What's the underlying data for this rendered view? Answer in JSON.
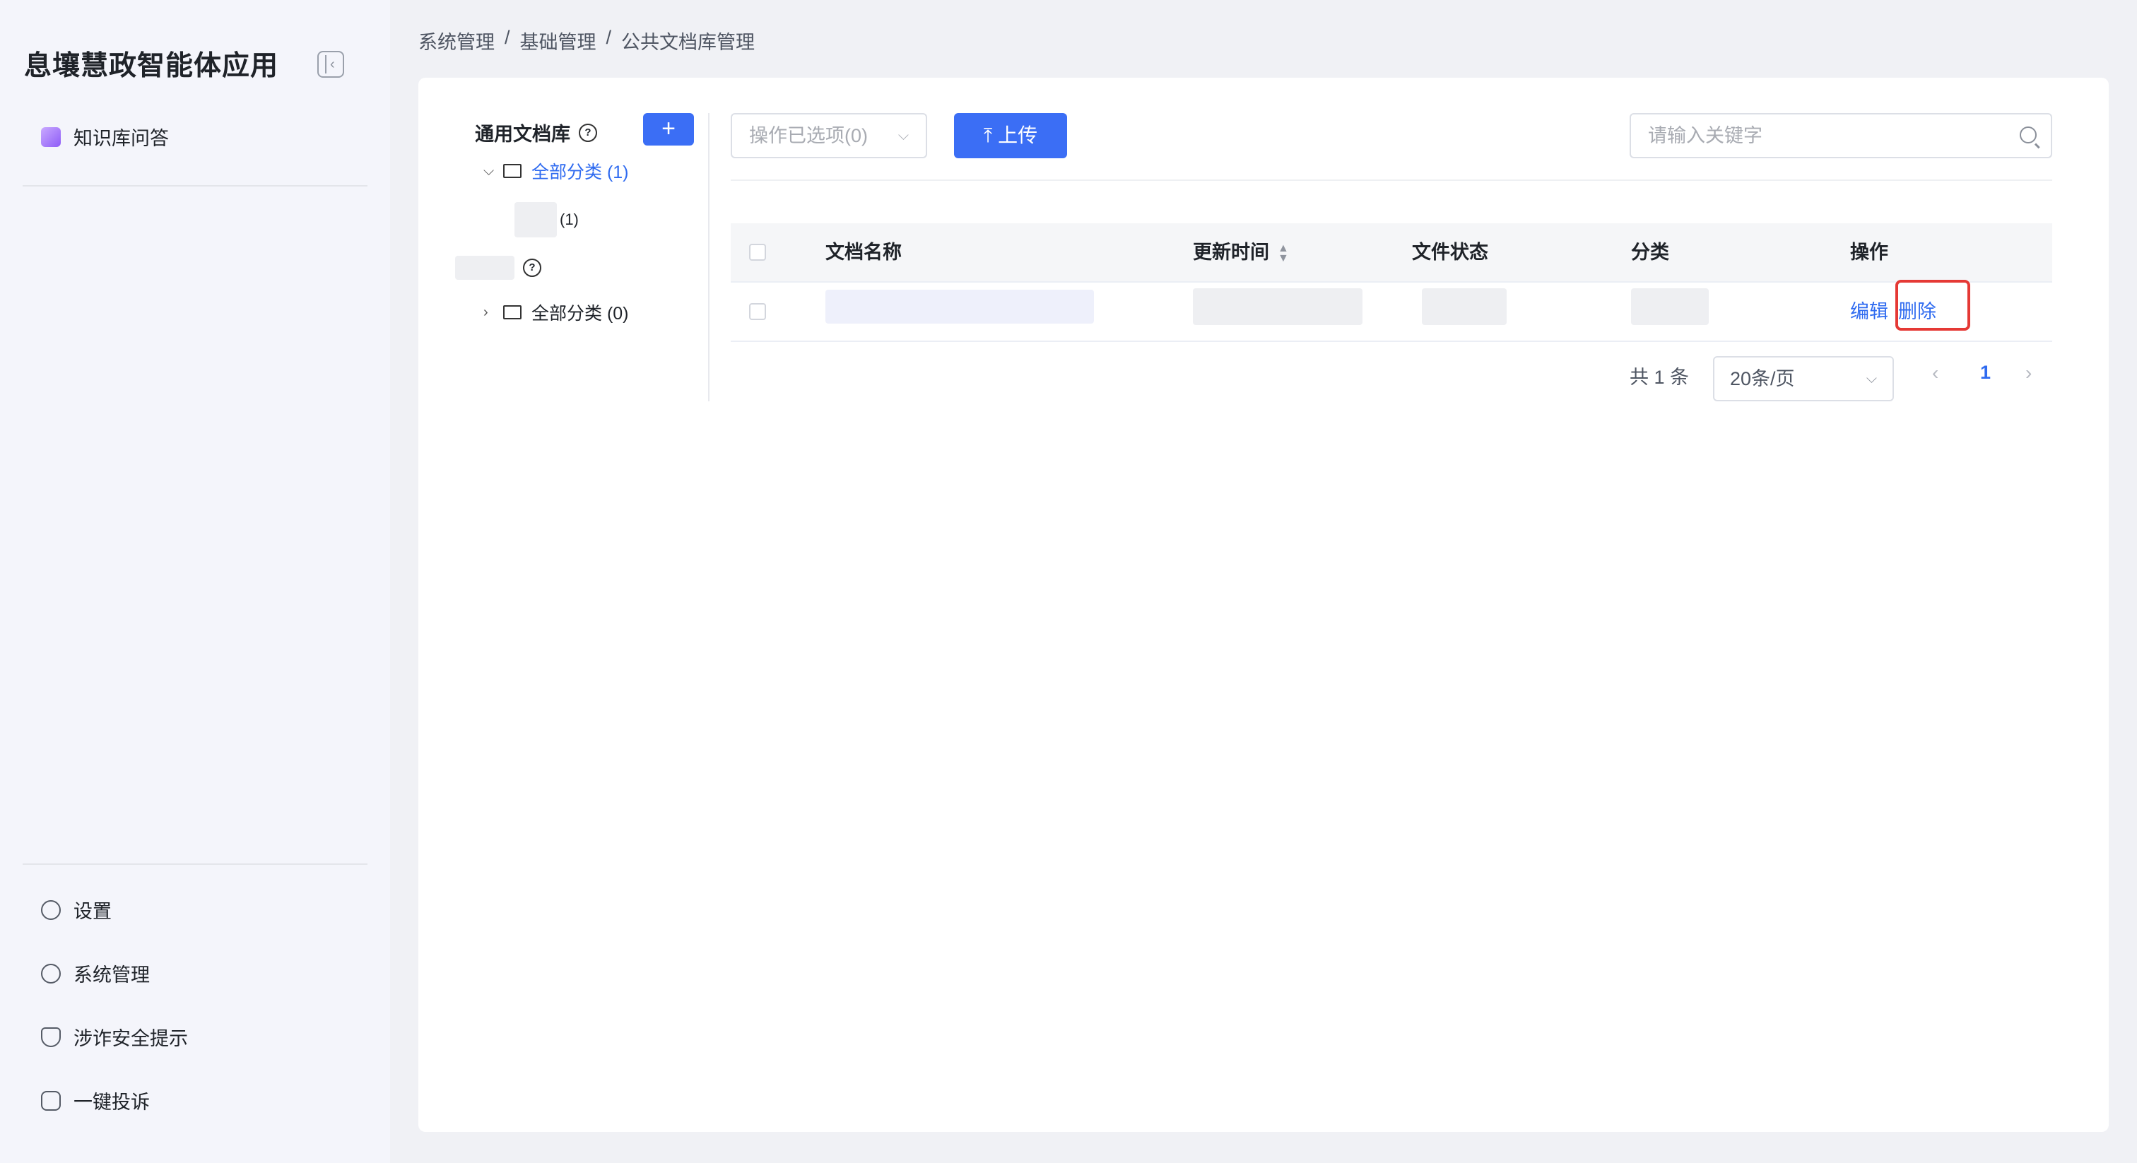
{
  "app": {
    "title": "息壤慧政智能体应用"
  },
  "sidebar": {
    "top_items": [
      {
        "label": "知识库问答",
        "icon": "knowledge-base-icon"
      }
    ],
    "bottom_items": [
      {
        "label": "设置",
        "icon": "settings-icon"
      },
      {
        "label": "系统管理",
        "icon": "user-admin-icon"
      },
      {
        "label": "涉诈安全提示",
        "icon": "shield-icon"
      },
      {
        "label": "一键投诉",
        "icon": "complaint-icon"
      }
    ]
  },
  "breadcrumb": {
    "items": [
      "系统管理",
      "基础管理",
      "公共文档库管理"
    ],
    "separator": "/"
  },
  "tree": {
    "title": "通用文档库",
    "add_label": "+",
    "nodes": [
      {
        "label": "全部分类 (1)",
        "expanded": true,
        "selected": true
      },
      {
        "label": "(1)"
      },
      {
        "label": "全部分类 (0)",
        "expanded": false
      }
    ]
  },
  "toolbar": {
    "ops_select": "操作已选项(0)",
    "upload_label": "上传",
    "search_placeholder": "请输入关键字"
  },
  "table": {
    "columns": [
      "文档名称",
      "更新时间",
      "文件状态",
      "分类",
      "操作"
    ],
    "rows": [
      {
        "actions": [
          "编辑",
          "删除"
        ]
      }
    ]
  },
  "pagination": {
    "total": "共 1 条",
    "page_size": "20条/页",
    "current_page": "1"
  },
  "colors": {
    "primary": "#3b6ef5",
    "highlight": "#e53935"
  }
}
